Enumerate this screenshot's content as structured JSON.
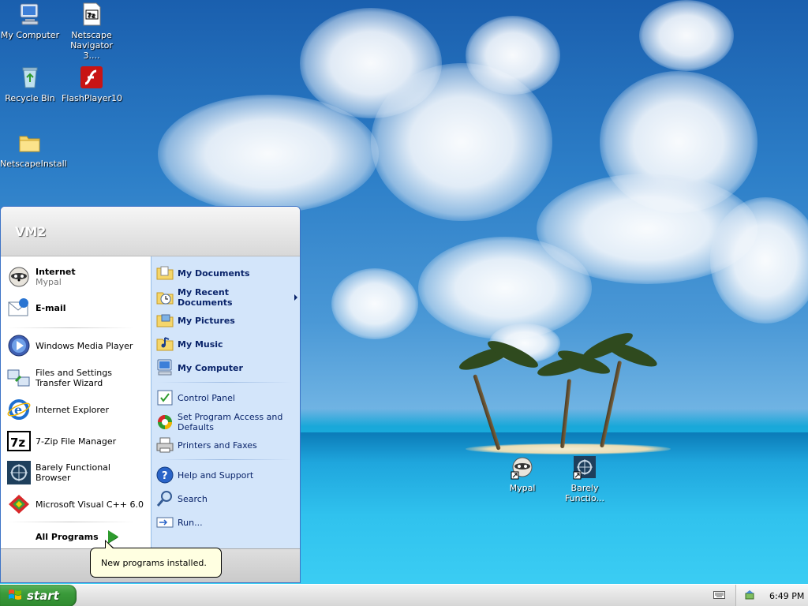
{
  "desktop": {
    "icons": [
      {
        "label": "My Computer"
      },
      {
        "label": "Netscape Navigator 3...."
      },
      {
        "label": "Recycle Bin"
      },
      {
        "label": "FlashPlayer10"
      },
      {
        "label": "NetscapeInstall"
      },
      {
        "label": "Mypal"
      },
      {
        "label": "Barely Functio..."
      }
    ]
  },
  "start_menu": {
    "user_name": "VM2",
    "pinned": [
      {
        "label": "Internet",
        "sub": "Mypal"
      },
      {
        "label": "E-mail"
      }
    ],
    "recent": [
      {
        "label": "Windows Media Player"
      },
      {
        "label": "Files and Settings Transfer Wizard"
      },
      {
        "label": "Internet Explorer"
      },
      {
        "label": "7-Zip File Manager"
      },
      {
        "label": "Barely Functional Browser"
      },
      {
        "label": "Microsoft Visual C++ 6.0"
      }
    ],
    "all_programs": "All Programs",
    "right": [
      {
        "label": "My Documents"
      },
      {
        "label": "My Recent Documents"
      },
      {
        "label": "My Pictures"
      },
      {
        "label": "My Music"
      },
      {
        "label": "My Computer"
      },
      {
        "label": "Control Panel"
      },
      {
        "label": "Set Program Access and Defaults"
      },
      {
        "label": "Printers and Faxes"
      },
      {
        "label": "Help and Support"
      },
      {
        "label": "Search"
      },
      {
        "label": "Run..."
      }
    ]
  },
  "balloon": {
    "text": "New programs installed."
  },
  "taskbar": {
    "start_label": "start",
    "clock": "6:49 PM"
  },
  "colors": {
    "start_green": "#3a9a3a",
    "menu_blue": "#3d73c6",
    "right_pane": "#d3e5fa",
    "link_text": "#0a246a"
  }
}
